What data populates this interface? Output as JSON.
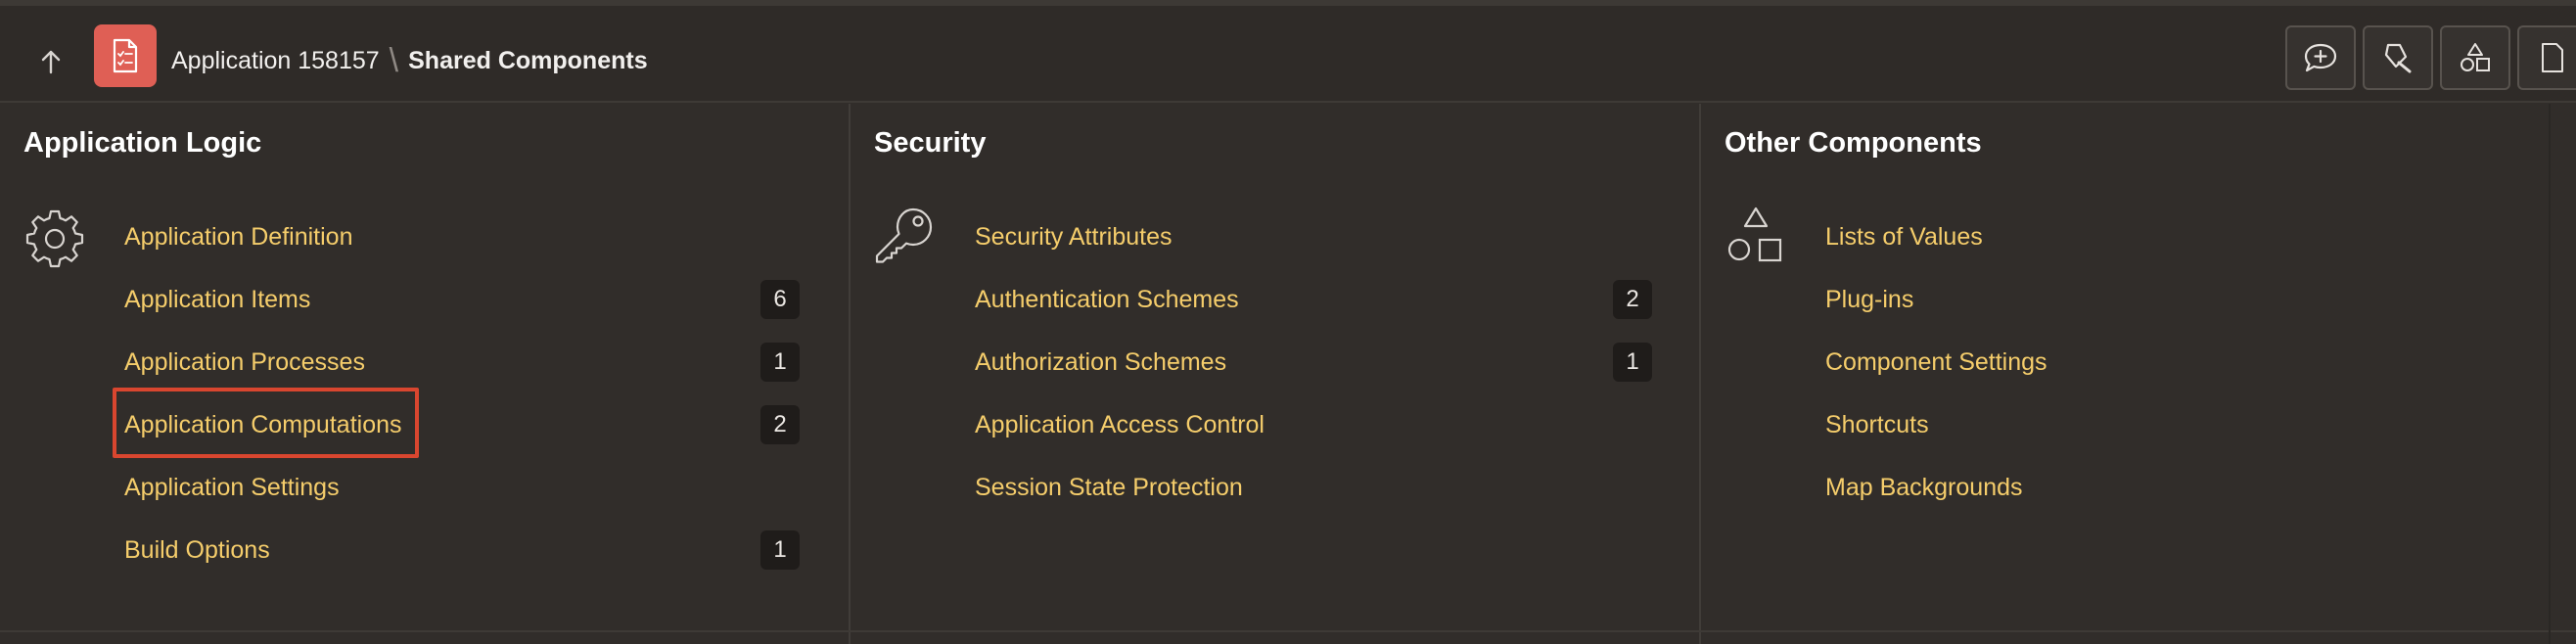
{
  "header": {
    "app_name": "Application 158157",
    "separator": "\\",
    "current": "Shared Components"
  },
  "toolbar": {
    "buttons": [
      {
        "icon": "comment-plus-icon"
      },
      {
        "icon": "flashlight-icon"
      },
      {
        "icon": "shapes-icon"
      },
      {
        "icon": "page-icon"
      }
    ]
  },
  "columns": [
    {
      "title": "Application Logic",
      "icon": "gear-icon",
      "links": [
        {
          "label": "Application Definition",
          "count": null
        },
        {
          "label": "Application Items",
          "count": "6"
        },
        {
          "label": "Application Processes",
          "count": "1"
        },
        {
          "label": "Application Computations",
          "count": "2"
        },
        {
          "label": "Application Settings",
          "count": null
        },
        {
          "label": "Build Options",
          "count": "1"
        }
      ]
    },
    {
      "title": "Security",
      "icon": "key-icon",
      "links": [
        {
          "label": "Security Attributes",
          "count": null
        },
        {
          "label": "Authentication Schemes",
          "count": "2"
        },
        {
          "label": "Authorization Schemes",
          "count": "1"
        },
        {
          "label": "Application Access Control",
          "count": null
        },
        {
          "label": "Session State Protection",
          "count": null
        }
      ]
    },
    {
      "title": "Other Components",
      "icon": "shapes-icon",
      "links": [
        {
          "label": "Lists of Values",
          "count": null
        },
        {
          "label": "Plug-ins",
          "count": null
        },
        {
          "label": "Component Settings",
          "count": null
        },
        {
          "label": "Shortcuts",
          "count": null
        },
        {
          "label": "Map Backgrounds",
          "count": null
        }
      ]
    }
  ],
  "colors": {
    "background": "#312d2a",
    "link": "#f5cd6b",
    "app_icon": "#df5f55",
    "highlight": "#d9462f",
    "badge": "#1f1c1a"
  }
}
